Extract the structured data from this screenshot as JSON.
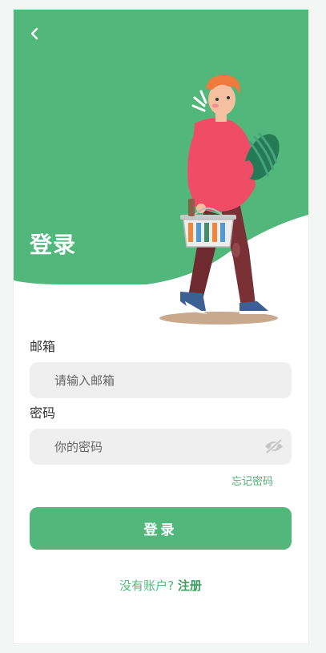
{
  "header": {
    "title": "登录"
  },
  "icons": {
    "back": "chevron-left-icon",
    "password_toggle": "eye-off-icon"
  },
  "colors": {
    "primary": "#52b77a",
    "field_bg": "#efefef",
    "link": "#3f9e64"
  },
  "form": {
    "email_label": "邮箱",
    "email_placeholder": "请输入邮箱",
    "password_label": "密码",
    "password_placeholder": "你的密码",
    "forgot_label": "忘记密码",
    "submit_label": "登录"
  },
  "footer": {
    "prompt": "没有账户?",
    "signup_label": "注册"
  }
}
